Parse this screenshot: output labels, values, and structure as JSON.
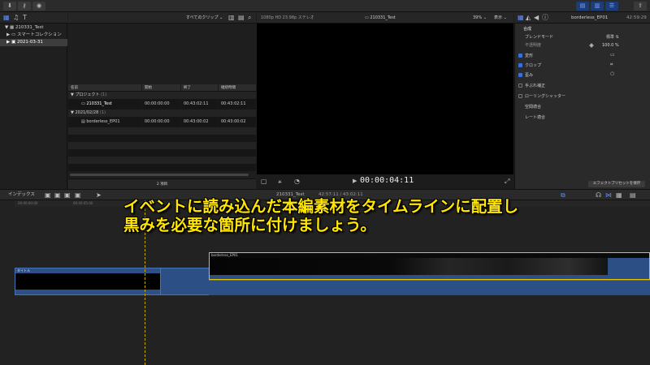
{
  "library": {
    "items": [
      {
        "label": "210331_Test",
        "arrow": "▼"
      },
      {
        "label": "スマートコレクション",
        "arrow": "▶"
      },
      {
        "label": "2021-03-31",
        "arrow": "▶"
      }
    ]
  },
  "browser": {
    "filter": "すべてのクリップ",
    "columns": [
      "名前",
      "開始",
      "終了",
      "継続時間"
    ],
    "groups": [
      {
        "label": "プロジェクト",
        "count": "(1)"
      },
      {
        "label": "2021/02/28",
        "count": "(1)"
      }
    ],
    "rows": [
      {
        "name": "210331_Test",
        "start": "00:00:00:00",
        "end": "00:43:02:11",
        "duration": "00:43:02:11"
      },
      {
        "name": "borderless_EP01",
        "start": "00:00:00:00",
        "end": "00:43:00:02",
        "duration": "00:43:00:02"
      }
    ],
    "footer": "2 項目"
  },
  "viewer": {
    "format": "1080p HD 23.98p ステレオ",
    "project": "210331_Test",
    "zoom": "39%",
    "view": "表示",
    "timecode": "00:00:04:11"
  },
  "inspector": {
    "clip_name": "borderless_EP01",
    "time": "42:59:29",
    "section": "合成",
    "blend_label": "ブレンドモード",
    "blend_value": "標準",
    "opacity_label": "不透明度",
    "opacity_value": "100.0",
    "opacity_unit": "%",
    "checked_items": [
      "変形",
      "クロップ",
      "歪み"
    ],
    "unchecked_items": [
      "手ぶれ補正",
      "ローリングシャッター"
    ],
    "plain_items": [
      "空間適合",
      "レート適合"
    ],
    "save_button": "エフェクトプリセットを保存"
  },
  "timeline": {
    "index_label": "インデックス",
    "project_info": "210331_Test",
    "duration_info": "42:57:11 / 43:02:11",
    "ruler": [
      "00:00:00:00",
      "00:00:05:00"
    ],
    "clip_a_name": "タイトル",
    "clip_b_name": "borderless_EP01"
  },
  "caption": {
    "line1": "イベントに読み込んだ本編素材をタイムラインに配置し",
    "line2": "黒みを必要な箇所に付けましょう。"
  }
}
